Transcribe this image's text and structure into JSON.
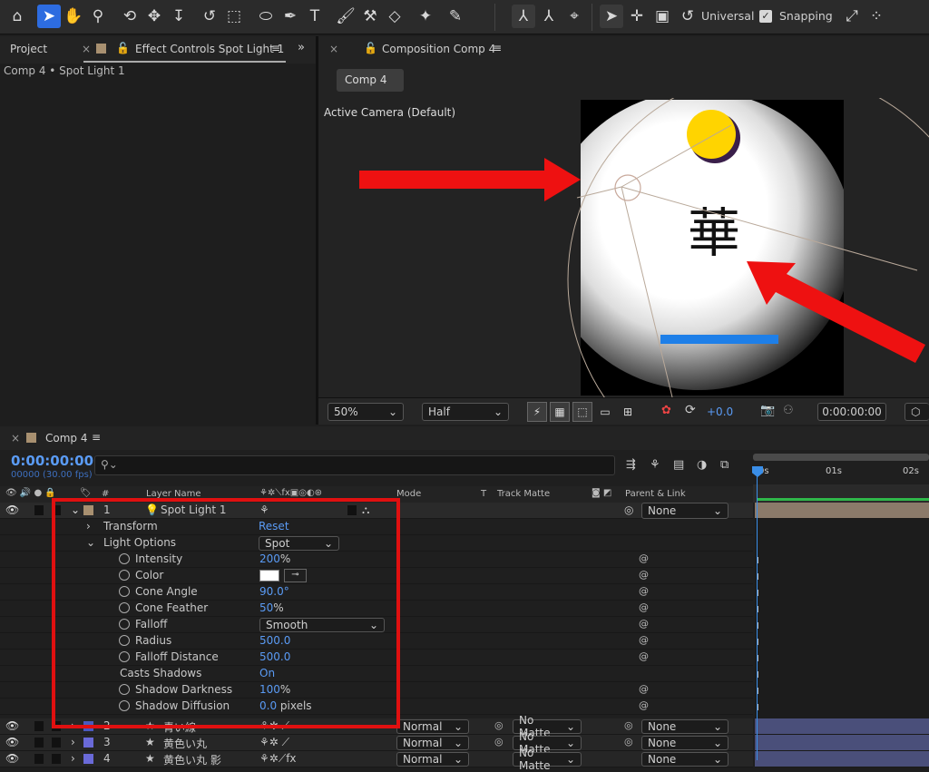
{
  "toolbar": {
    "universal": "Universal",
    "snapping": "Snapping"
  },
  "left_panel": {
    "tab_project": "Project",
    "tab_effect": "Effect Controls Spot Light 1",
    "breadcrumb": "Comp 4 • Spot Light 1"
  },
  "comp_panel": {
    "tab": "Composition Comp 4",
    "comp_button": "Comp 4",
    "camera": "Active Camera (Default)",
    "comp_glyph": "華"
  },
  "viewer_bar": {
    "zoom": "50%",
    "resolution": "Half",
    "exposure": "+0.0",
    "timecode": "0:00:00:00"
  },
  "timeline": {
    "tab": "Comp 4",
    "timecode": "0:00:00:00",
    "frames": "00000 (30.00 fps)",
    "search_placeholder": "",
    "headers": {
      "num": "#",
      "layer_name": "Layer Name",
      "mode": "Mode",
      "t": "T",
      "track_matte": "Track Matte",
      "parent": "Parent & Link"
    },
    "ruler": {
      "t0": "0s",
      "t1": "01s",
      "t2": "02s"
    },
    "layer1": {
      "num": "1",
      "name": "Spot Light 1",
      "parent": "None"
    },
    "transform": {
      "label": "Transform",
      "reset": "Reset"
    },
    "light_options": {
      "label": "Light Options",
      "type": "Spot"
    },
    "props": [
      {
        "label": "Intensity",
        "value": "200",
        "unit": "%"
      },
      {
        "label": "Color",
        "value": "",
        "unit": ""
      },
      {
        "label": "Cone Angle",
        "value": "90.0°",
        "unit": ""
      },
      {
        "label": "Cone Feather",
        "value": "50",
        "unit": "%"
      },
      {
        "label": "Falloff",
        "value": "Smooth",
        "unit": ""
      },
      {
        "label": "Radius",
        "value": "500.0",
        "unit": ""
      },
      {
        "label": "Falloff Distance",
        "value": "500.0",
        "unit": ""
      },
      {
        "label": "Casts Shadows",
        "value": "On",
        "unit": ""
      },
      {
        "label": "Shadow Darkness",
        "value": "100",
        "unit": "%"
      },
      {
        "label": "Shadow Diffusion",
        "value": "0.0",
        "unit": " pixels"
      }
    ],
    "layers": [
      {
        "num": "2",
        "name": "青い線",
        "mode": "Normal",
        "matte": "No Matte",
        "parent": "None",
        "color": "#4a5ac0"
      },
      {
        "num": "3",
        "name": "黄色い丸",
        "mode": "Normal",
        "matte": "No Matte",
        "parent": "None",
        "color": "#6a6ad8"
      },
      {
        "num": "4",
        "name": "黄色い丸 影",
        "mode": "Normal",
        "matte": "No Matte",
        "parent": "None",
        "color": "#6a6ad8"
      }
    ]
  },
  "colors": {
    "accent": "#2d6ce0",
    "blue_value": "#5a9bf5",
    "highlight_box": "#e01010",
    "arrow": "#ee1111",
    "sun": "#ffd400",
    "bar": "#1e7fe8"
  }
}
